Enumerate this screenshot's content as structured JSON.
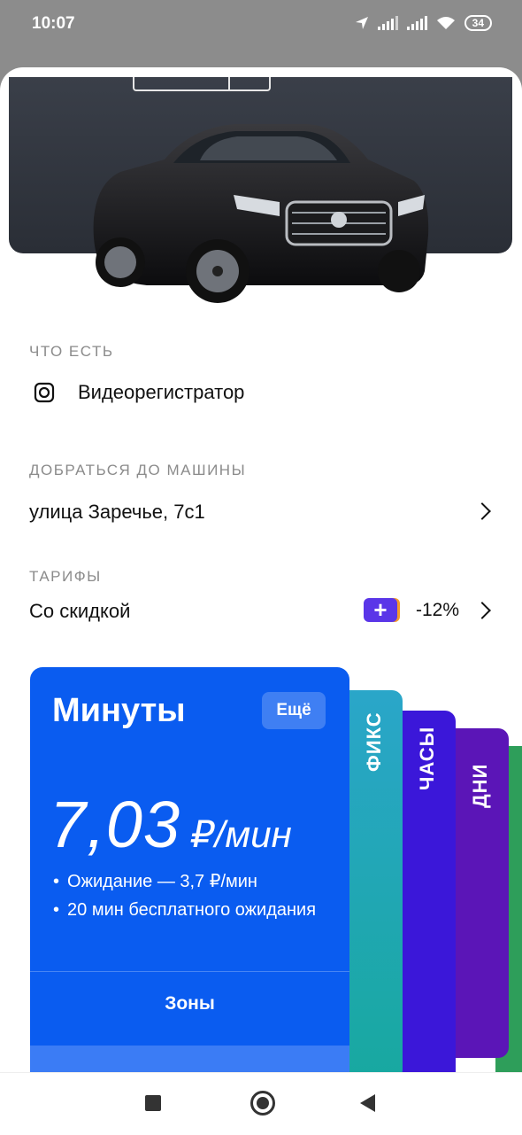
{
  "status_bar": {
    "time": "10:07",
    "battery": "34"
  },
  "features": {
    "label": "ЧТО ЕСТЬ",
    "items": [
      {
        "icon": "dashcam-icon",
        "label": "Видеорегистратор"
      }
    ]
  },
  "reach_car": {
    "label": "ДОБРАТЬСЯ ДО МАШИНЫ",
    "address": "улица Заречье, 7с1"
  },
  "tariffs": {
    "label": "ТАРИФЫ",
    "mode": "Со скидкой",
    "plus_badge": "+",
    "discount": "-12%"
  },
  "tariff_cards": {
    "main": {
      "title": "Минуты",
      "more_button": "Ещё",
      "price_value": "7,03",
      "price_unit": "₽/мин",
      "bullets": [
        "Ожидание — 3,7 ₽/мин",
        "20 мин бесплатного ожидания"
      ],
      "zones_button": "Зоны"
    },
    "others": [
      "ФИКС",
      "ЧАСЫ",
      "ДНИ"
    ]
  },
  "colors": {
    "main_card": "#0a5cf0",
    "fix_card": "#22a7b4",
    "hours_card": "#3b17d9",
    "days_card": "#5b15b7",
    "extra_card": "#2e9e5a"
  }
}
